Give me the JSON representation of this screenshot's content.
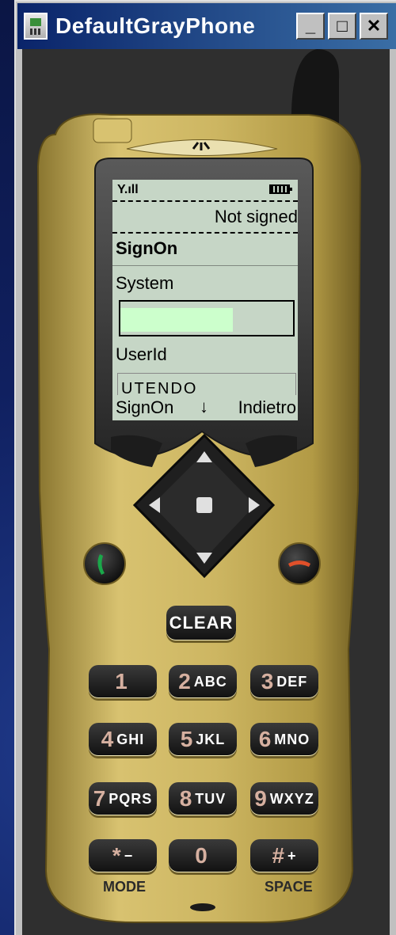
{
  "window": {
    "title": "DefaultGrayPhone",
    "buttons": {
      "minimize": "_",
      "maximize": "□",
      "close": "✕"
    }
  },
  "screen": {
    "status": {
      "signal": "Y.ıll",
      "battery_icon": "battery-icon"
    },
    "header": "Not signed",
    "form_title": "SignOn",
    "fields": [
      {
        "label": "System",
        "value": ""
      },
      {
        "label": "UserId",
        "value": "UTENDO"
      }
    ],
    "softkeys": {
      "left": "SignOn",
      "middle": "↓",
      "right": "Indietro"
    }
  },
  "keys": {
    "clear": "CLEAR",
    "keypad": [
      {
        "num": "1",
        "letters": ""
      },
      {
        "num": "2",
        "letters": "ABC"
      },
      {
        "num": "3",
        "letters": "DEF"
      },
      {
        "num": "4",
        "letters": "GHI"
      },
      {
        "num": "5",
        "letters": "JKL"
      },
      {
        "num": "6",
        "letters": "MNO"
      },
      {
        "num": "7",
        "letters": "PQRS"
      },
      {
        "num": "8",
        "letters": "TUV"
      },
      {
        "num": "9",
        "letters": "WXYZ"
      },
      {
        "num": "*",
        "letters": "−"
      },
      {
        "num": "0",
        "letters": ""
      },
      {
        "num": "#",
        "letters": "+"
      }
    ],
    "mode_label": "MODE",
    "space_label": "SPACE"
  },
  "colors": {
    "phone_body": "#c9b35c",
    "lcd_bg": "#c6d6c6",
    "field_highlight": "#ccffcc",
    "call_green": "#1aa84a",
    "end_red": "#e0502a"
  }
}
